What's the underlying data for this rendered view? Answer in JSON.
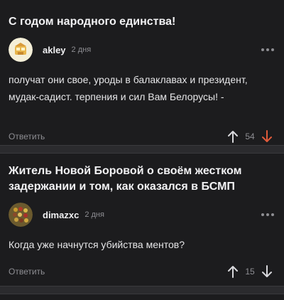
{
  "posts": [
    {
      "title": "С годом народного единства!",
      "author": "akley",
      "time": "2 дня",
      "comment": "получат они свое, уроды в балаклавах и президент, мудак-садист. терпения и сил Вам Белорусы! -",
      "reply_label": "Ответить",
      "score": "54"
    },
    {
      "title": "Житель Новой Боровой о своём жестком задержании и том, как оказался в БСМП",
      "author": "dimazxc",
      "time": "2 дня",
      "comment": "Когда уже начнутся убийства ментов?",
      "reply_label": "Ответить",
      "score": "15"
    }
  ],
  "icons": {
    "more": "more-dots-icon",
    "upvote": "arrow-up-icon",
    "downvote": "arrow-down-icon"
  },
  "colors": {
    "background": "#1c1c1e",
    "divider": "#2b2b2e",
    "downvote_active": "#e05a3a",
    "muted": "#8e8e93"
  }
}
